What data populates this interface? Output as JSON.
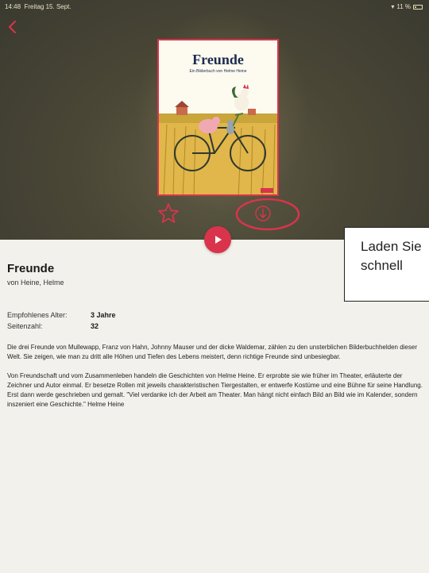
{
  "status_bar": {
    "time": "14:48",
    "date": "Freitag 15. Sept.",
    "battery": "11 %"
  },
  "book": {
    "cover_title": "Freunde",
    "cover_subtitle": "Ein Bilderbuch von Helme Heine",
    "cover_publisher": "BELTZ",
    "title": "Freunde",
    "author": "von Heine, Helme",
    "details": [
      {
        "label": "Empfohlenes Alter:",
        "value": "3 Jahre"
      },
      {
        "label": "Seitenzahl:",
        "value": "32"
      }
    ],
    "description": [
      "Die drei Freunde von Mullewapp, Franz von Hahn, Johnny Mauser und der dicke Waldemar, zählen zu den unsterblichen Bilderbuchhelden dieser Welt. Sie zeigen, wie man zu dritt alle Höhen und Tiefen des Lebens meistert, denn richtige Freunde sind unbesiegbar.",
      "Von Freundschaft und vom Zusammenleben handeln die Geschichten von Helme Heine. Er erprobte sie wie früher im Theater, erläuterte der Zeichner und Autor einmal. Er besetze Rollen mit jeweils charakteristischen Tiergestalten, er entwerfe Kostüme und eine Bühne für seine Handlung. Erst dann werde geschrieben und gemalt. \"Viel verdanke ich der Arbeit am Theater. Man hängt nicht einfach Bild an Bild wie im Kalender, sondern inszeniert eine Geschichte.\" Helme Heine"
    ]
  },
  "callout": {
    "line1": "Laden Sie",
    "line2": "schnell"
  },
  "icons": {
    "back": "chevron-left-icon",
    "favorite": "star-icon",
    "download": "download-icon",
    "play": "play-icon"
  },
  "colors": {
    "accent": "#d9344b",
    "background": "#f3f1ec",
    "hero": "#4a4736"
  }
}
